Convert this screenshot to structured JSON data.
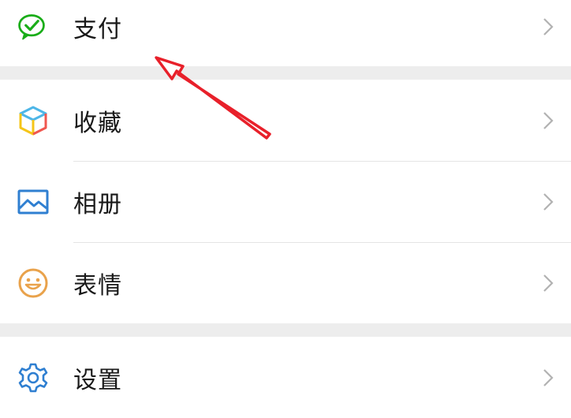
{
  "menu": {
    "pay": {
      "label": "支付",
      "icon": "wechat-pay-icon",
      "color": "#1aad19"
    },
    "favorites": {
      "label": "收藏",
      "icon": "cube-icon",
      "color": "#f5a623"
    },
    "album": {
      "label": "相册",
      "icon": "picture-icon",
      "color": "#2f7fd1"
    },
    "stickers": {
      "label": "表情",
      "icon": "smile-icon",
      "color": "#e9a24b"
    },
    "settings": {
      "label": "设置",
      "icon": "gear-icon",
      "color": "#2f7fd1"
    }
  },
  "colors": {
    "background": "#ededed",
    "row": "#ffffff",
    "text": "#191919",
    "chevron": "#b2b2b2",
    "annotation_arrow": "#e8202a"
  }
}
